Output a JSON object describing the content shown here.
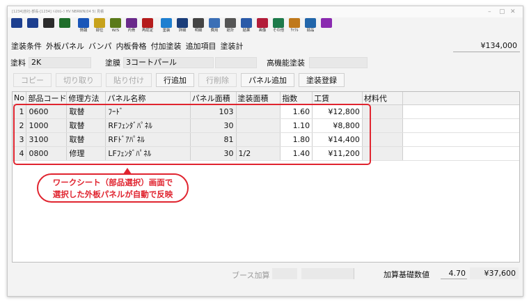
{
  "titlebar": {
    "text": "[1234]自社-部長-[1234] ﾄﾖﾀｶﾛｰﾗ HV NBRWN(04 5) 見積",
    "minimize": "–",
    "maximize": "▢",
    "close": "✕"
  },
  "toolbar": {
    "buttons": [
      {
        "label": "",
        "icon": "save-icon",
        "color": "#1d3f8f"
      },
      {
        "label": "",
        "icon": "save-as-icon",
        "color": "#1d3f8f"
      },
      {
        "label": "",
        "icon": "print-icon",
        "color": "#2b2b2b"
      },
      {
        "label": "",
        "icon": "exit-icon",
        "color": "#1f6e2a"
      },
      {
        "label": "情報",
        "icon": "info-icon",
        "color": "#1a56b8"
      },
      {
        "label": "部位",
        "icon": "parts-icon",
        "color": "#c7a21b"
      },
      {
        "label": "W/S",
        "icon": "worksheet-icon",
        "color": "#5a7a1a"
      },
      {
        "label": "内骨",
        "icon": "frame-icon",
        "color": "#6a2a8a"
      },
      {
        "label": "再認定",
        "icon": "recert-icon",
        "color": "#b51d1d"
      },
      {
        "label": "塗装",
        "icon": "paint-icon",
        "color": "#1e7fd0"
      },
      {
        "label": "詳細",
        "icon": "detail-icon",
        "color": "#1a3d7a"
      },
      {
        "label": "明細",
        "icon": "list-icon",
        "color": "#444444"
      },
      {
        "label": "費用",
        "icon": "cost-icon",
        "color": "#3b6fb6"
      },
      {
        "label": "総計",
        "icon": "total-icon",
        "color": "#555555"
      },
      {
        "label": "結果",
        "icon": "result-icon",
        "color": "#2a5aa8"
      },
      {
        "label": "画像",
        "icon": "image-icon",
        "color": "#b31d3a"
      },
      {
        "label": "その他",
        "icon": "other-icon",
        "color": "#1d7a4a"
      },
      {
        "label": "ｻｲｸﾙ",
        "icon": "cycle-icon",
        "color": "#c0791b"
      },
      {
        "label": "部品",
        "icon": "car-icon",
        "color": "#2266aa"
      },
      {
        "label": "",
        "icon": "diamond-icon",
        "color": "#8a2ab0"
      }
    ]
  },
  "tabs": [
    "塗装条件",
    "外板パネル",
    "バンパ",
    "内板骨格",
    "付加塗装",
    "追加項目",
    "塗装計"
  ],
  "total": "¥134,000",
  "fields": {
    "paint_label": "塗料",
    "paint_value": "2K",
    "coat_label": "塗膜",
    "coat_value": "3コートパール",
    "high_label": "高機能塗装",
    "high_value": ""
  },
  "actions": [
    {
      "label": "コピー",
      "enabled": false
    },
    {
      "label": "切り取り",
      "enabled": false
    },
    {
      "label": "貼り付け",
      "enabled": false
    },
    {
      "label": "行追加",
      "enabled": true
    },
    {
      "label": "行削除",
      "enabled": false
    },
    {
      "label": "パネル追加",
      "enabled": true
    },
    {
      "label": "塗装登録",
      "enabled": true
    }
  ],
  "table": {
    "headers": [
      "No",
      "部品コード",
      "修理方法",
      "パネル名称",
      "パネル面積",
      "塗装面積",
      "指数",
      "工賃",
      "材料代"
    ],
    "rows": [
      {
        "no": "1",
        "code": "0600",
        "method": "取替",
        "name": "ﾌｰﾄﾞ",
        "panel_area": "103",
        "paint_area": "",
        "index": "1.60",
        "labor": "¥12,800",
        "material": ""
      },
      {
        "no": "2",
        "code": "1000",
        "method": "取替",
        "name": "RFﾌｪﾝﾀﾞﾊﾟﾈﾙ",
        "panel_area": "30",
        "paint_area": "",
        "index": "1.10",
        "labor": "¥8,800",
        "material": ""
      },
      {
        "no": "3",
        "code": "3100",
        "method": "取替",
        "name": "RFﾄﾞｱﾊﾟﾈﾙ",
        "panel_area": "81",
        "paint_area": "",
        "index": "1.80",
        "labor": "¥14,400",
        "material": ""
      },
      {
        "no": "4",
        "code": "0800",
        "method": "修理",
        "name": "LFﾌｪﾝﾀﾞﾊﾟﾈﾙ",
        "panel_area": "30",
        "paint_area": "1/2",
        "index": "1.40",
        "labor": "¥11,200",
        "material": ""
      }
    ]
  },
  "callout": {
    "line1": "ワークシート（部品選択）画面で",
    "line2": "選択した外板パネルが自動で反映",
    "color": "#e0242f"
  },
  "footer": {
    "booth_label": "ブース加算",
    "base_label": "加算基礎数値",
    "base_index": "4.70",
    "base_amount": "¥37,600"
  }
}
